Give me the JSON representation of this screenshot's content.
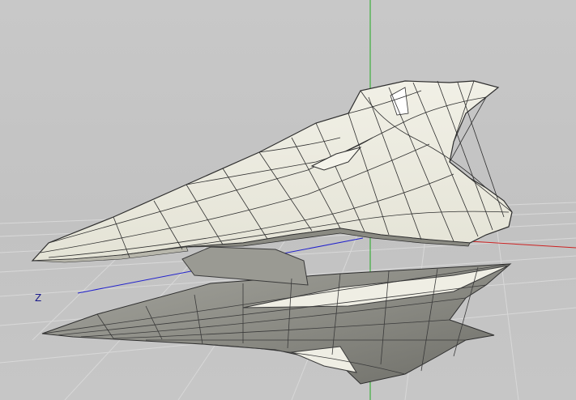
{
  "viewport": {
    "axis_labels": {
      "z": "Z"
    },
    "colors": {
      "background": "#c4c4c4",
      "grid": "#dadada",
      "axis_x": "#cc2222",
      "axis_y": "#22aa22",
      "axis_z": "#2222cc",
      "mesh_fill": "#ecebe0",
      "mesh_shadow": "#8a8a82",
      "mesh_edge": "#3a3a3a",
      "reflection": "#8f8f88"
    },
    "objects": [
      {
        "name": "fuselage-mesh",
        "type": "polygon-mesh"
      },
      {
        "name": "fuselage-reflection",
        "type": "mirror-preview"
      }
    ]
  }
}
